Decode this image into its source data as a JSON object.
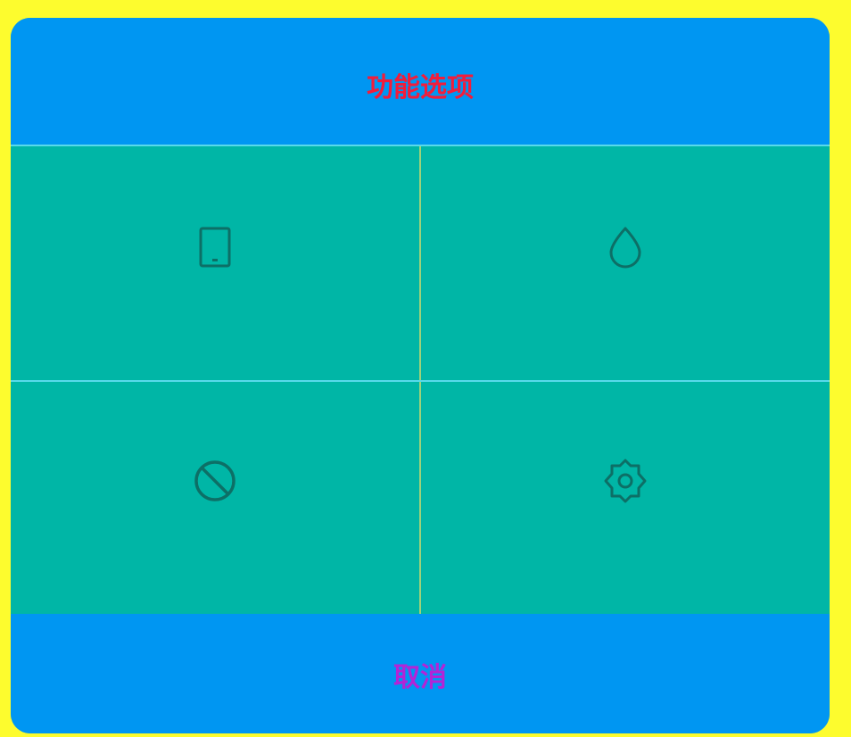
{
  "dialog": {
    "title": "功能选项",
    "options": [
      {
        "icon": "tablet-icon"
      },
      {
        "icon": "water-drop-icon"
      },
      {
        "icon": "block-icon"
      },
      {
        "icon": "settings-gear-icon"
      }
    ],
    "cancel_label": "取消"
  },
  "colors": {
    "page_background": "#fdfc2e",
    "header_background": "#0096f2",
    "grid_background": "#00b6a6",
    "icon_color": "#0d6f66",
    "title_color": "#f21d3b",
    "cancel_color": "#b324d6"
  }
}
